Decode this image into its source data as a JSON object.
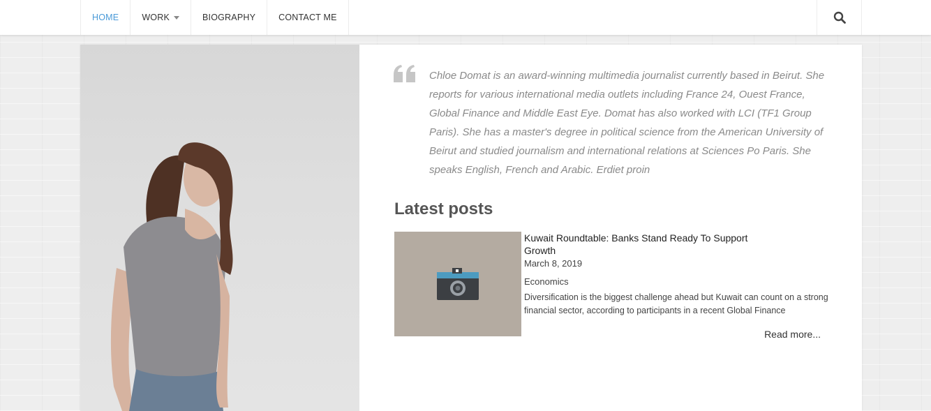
{
  "nav": {
    "items": [
      {
        "label": "HOME",
        "active": true
      },
      {
        "label": "WORK",
        "has_dropdown": true
      },
      {
        "label": "BIOGRAPHY"
      },
      {
        "label": "CONTACT ME"
      }
    ],
    "search_icon": "search-icon"
  },
  "profile": {
    "photo": "portrait-photo",
    "quote_icon": "quote-icon",
    "bio": "Chloe Domat is an award-winning multimedia journalist currently based in Beirut. She reports for various international media outlets including France 24, Ouest France, Global Finance and Middle East Eye. Domat has also worked with LCI (TF1 Group Paris). She has a master's degree in political science from the American University of Beirut and studied journalism and international relations at Sciences Po Paris. She speaks English, French and Arabic. Erdiet proin"
  },
  "latest_posts": {
    "heading": "Latest posts",
    "posts": [
      {
        "thumbnail_icon": "camera-icon",
        "title": "Kuwait Roundtable: Banks Stand Ready To Support Growth",
        "date": "March 8, 2019",
        "category": "Economics",
        "excerpt": "Diversification is the biggest challenge ahead but Kuwait can count on a strong financial sector, according to participants in a recent Global Finance",
        "read_more": "Read more..."
      }
    ]
  },
  "colors": {
    "accent": "#4a9ad8",
    "thumb_bg": "#b4aba1",
    "page_bg": "#eeeeee"
  }
}
